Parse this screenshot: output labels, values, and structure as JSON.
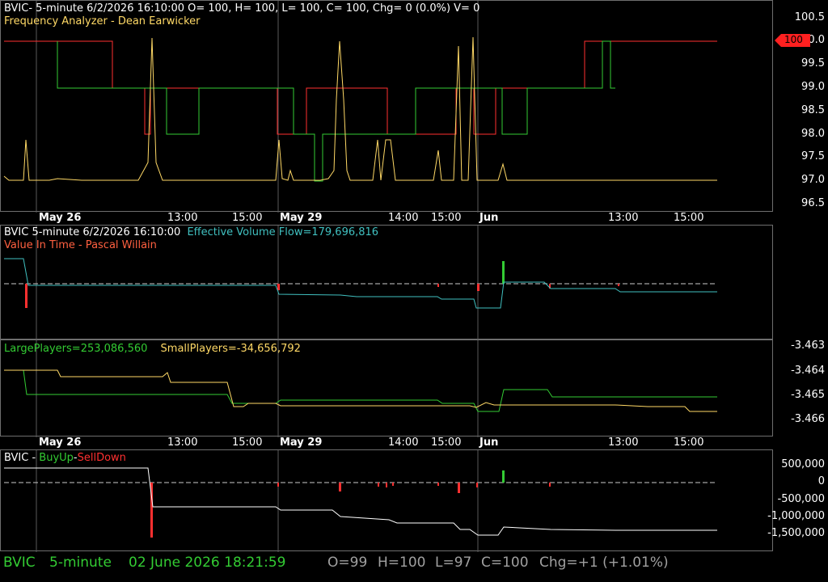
{
  "pane1": {
    "header_line1": "BVIC- 5-minute 6/2/2026 16:10:00 O= 100, H= 100, L= 100, C= 100, Chg= 0 (0.0%) V= 0",
    "header_line2": "Frequency Analyzer - Dean Earwicker",
    "price_axis": [
      "100.5",
      "100.0",
      "99.5",
      "99.0",
      "98.5",
      "98.0",
      "97.5",
      "97.0",
      "96.5"
    ],
    "last_price_tag": "100"
  },
  "time_axis": [
    "May 26",
    "13:00",
    "15:00",
    "May 29",
    "14:00",
    "15:00",
    "Jun",
    "13:00",
    "15:00"
  ],
  "pane2": {
    "symbol_label": "BVIC 5-minute  6/2/2026 16:10:00",
    "effective_volume_flow": "Effective Volume Flow=179,696,816",
    "subtitle": "Value In Time - Pascal Willain"
  },
  "pane3": {
    "large_players": "LargePlayers=253,086,560",
    "small_players": "SmallPlayers=-34,656,792",
    "axis": [
      "-3.463",
      "-3.464",
      "-3.465",
      "-3.466"
    ]
  },
  "pane4": {
    "label_symbol": "BVIC - ",
    "label_buyup": "BuyUp",
    "label_dash": "-",
    "label_selldown": "SellDown",
    "axis": [
      "500,000",
      "0",
      "-500,000",
      "-1,000,000",
      "-1,500,000"
    ]
  },
  "status": {
    "symbol": "BVIC",
    "interval": "5-minute",
    "datetime": "02 June 2026 18:21:59",
    "open": "O=99",
    "high": "H=100",
    "low": "L=97",
    "close": "C=100",
    "change": "Chg=+1 (+1.01%)"
  },
  "colors": {
    "green": "#33cc33",
    "red": "#ff3030",
    "yellow": "#ffd966",
    "cyan": "#40c0c0",
    "orange": "#ff6040",
    "grid": "#5a5a5a"
  }
}
